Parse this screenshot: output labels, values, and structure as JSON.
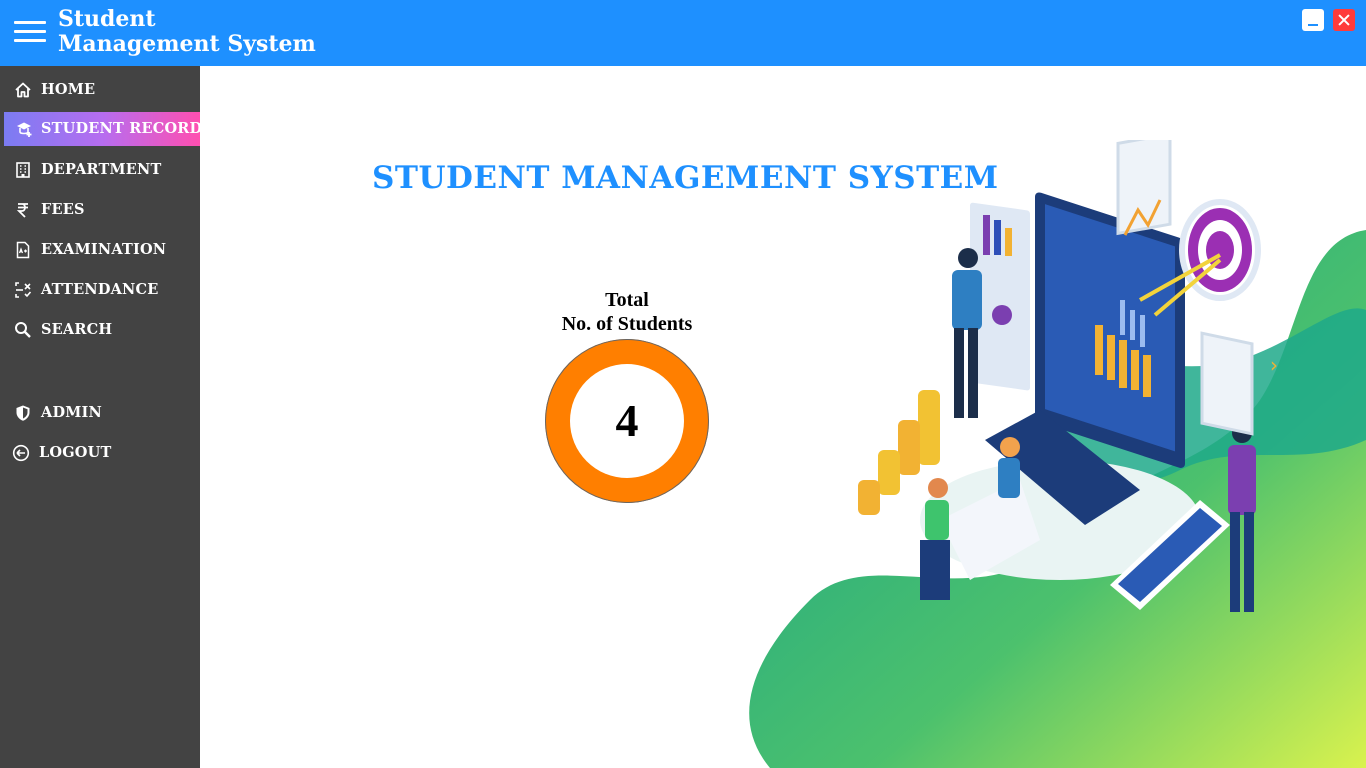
{
  "window": {
    "title_line1": "Student",
    "title_line2": "Management System"
  },
  "sidebar": {
    "items": [
      {
        "label": "HOME",
        "icon": "home-icon"
      },
      {
        "label": "STUDENT RECORD",
        "icon": "graduation-cap-icon",
        "active": true
      },
      {
        "label": "DEPARTMENT",
        "icon": "building-icon"
      },
      {
        "label": "FEES",
        "icon": "rupee-icon"
      },
      {
        "label": "EXAMINATION",
        "icon": "exam-document-icon"
      },
      {
        "label": "ATTENDANCE",
        "icon": "attendance-icon"
      },
      {
        "label": "SEARCH",
        "icon": "search-icon"
      },
      {
        "label": "ADMIN",
        "icon": "shield-icon"
      },
      {
        "label": "LOGOUT",
        "icon": "logout-icon"
      }
    ]
  },
  "main": {
    "heading": "STUDENT MANAGEMENT SYSTEM",
    "stat_label_line1": "Total",
    "stat_label_line2": "No. of Students",
    "stat_value": "4"
  },
  "colors": {
    "titlebar": "#1e90ff",
    "sidebar": "#434343",
    "accent_gradient_start": "#7b7cf2",
    "accent_gradient_end": "#ff4fb0",
    "donut": "#ff7f00",
    "heading": "#1e90ff",
    "close_button": "#ff3b3b"
  }
}
